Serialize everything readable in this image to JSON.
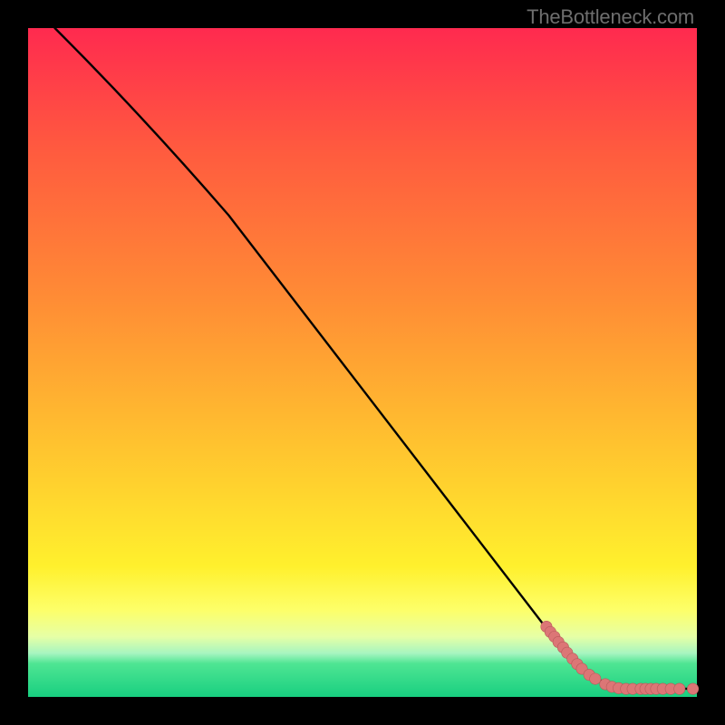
{
  "attribution": "TheBottleneck.com",
  "gradient_colors": {
    "c0": "#ff2a4f",
    "c1": "#ff5a3f",
    "c2": "#ff8b35",
    "c3": "#ffc22f",
    "c4": "#fff02d",
    "c5": "#fdff69",
    "c6": "#e6ffa6",
    "c7": "#a6f5c0",
    "c8": "#4fe593",
    "c9": "#18cf80"
  },
  "chart_data": {
    "type": "line",
    "title": "",
    "xlabel": "",
    "ylabel": "",
    "xlim": [
      0,
      100
    ],
    "ylim": [
      0,
      100
    ],
    "series": [
      {
        "name": "curve",
        "x": [
          4,
          30,
          80,
          87,
          100
        ],
        "y": [
          100,
          72,
          7,
          1.5,
          1.2
        ]
      }
    ],
    "markers": {
      "name": "scatter-points",
      "points": [
        {
          "x": 77.5,
          "y": 10.5
        },
        {
          "x": 78.1,
          "y": 9.7
        },
        {
          "x": 78.7,
          "y": 9.0
        },
        {
          "x": 79.3,
          "y": 8.2
        },
        {
          "x": 80.0,
          "y": 7.4
        },
        {
          "x": 80.6,
          "y": 6.6
        },
        {
          "x": 81.4,
          "y": 5.7
        },
        {
          "x": 82.1,
          "y": 4.9
        },
        {
          "x": 82.8,
          "y": 4.2
        },
        {
          "x": 83.9,
          "y": 3.3
        },
        {
          "x": 84.8,
          "y": 2.7
        },
        {
          "x": 86.3,
          "y": 1.9
        },
        {
          "x": 87.3,
          "y": 1.5
        },
        {
          "x": 88.3,
          "y": 1.3
        },
        {
          "x": 89.4,
          "y": 1.2
        },
        {
          "x": 90.4,
          "y": 1.2
        },
        {
          "x": 91.6,
          "y": 1.2
        },
        {
          "x": 92.3,
          "y": 1.2
        },
        {
          "x": 93.1,
          "y": 1.2
        },
        {
          "x": 93.9,
          "y": 1.2
        },
        {
          "x": 94.9,
          "y": 1.2
        },
        {
          "x": 96.1,
          "y": 1.2
        },
        {
          "x": 97.4,
          "y": 1.2
        },
        {
          "x": 99.4,
          "y": 1.2
        }
      ]
    }
  }
}
